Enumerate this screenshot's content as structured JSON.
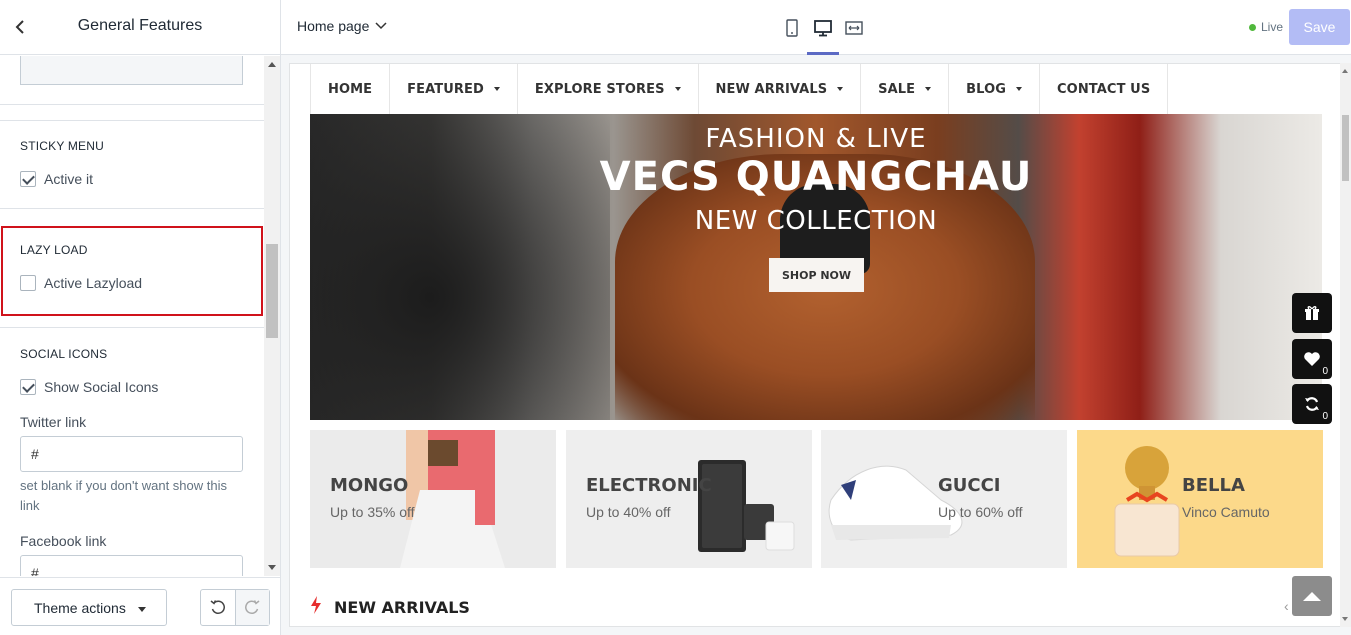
{
  "sidebar": {
    "title": "General Features",
    "sticky_menu": {
      "title": "STICKY MENU",
      "checkbox_label": "Active it",
      "checked": true
    },
    "lazy_load": {
      "title": "LAZY LOAD",
      "checkbox_label": "Active Lazyload",
      "checked": false
    },
    "social_icons": {
      "title": "SOCIAL ICONS",
      "checkbox_label": "Show Social Icons",
      "checked": true,
      "twitter_label": "Twitter link",
      "twitter_value": "#",
      "twitter_help": "set blank if you don't want show this link",
      "facebook_label": "Facebook link",
      "facebook_value": "#"
    },
    "footer": {
      "theme_actions": "Theme actions"
    }
  },
  "topbar": {
    "page_select": "Home page",
    "live_label": "Live",
    "save_label": "Save",
    "accent": "#5c6ac4"
  },
  "preview": {
    "nav": [
      {
        "label": "HOME",
        "dropdown": false
      },
      {
        "label": "FEATURED",
        "dropdown": true
      },
      {
        "label": "EXPLORE STORES",
        "dropdown": true
      },
      {
        "label": "NEW ARRIVALS",
        "dropdown": true
      },
      {
        "label": "SALE",
        "dropdown": true
      },
      {
        "label": "BLOG",
        "dropdown": true
      },
      {
        "label": "CONTACT US",
        "dropdown": false
      }
    ],
    "hero": {
      "line1": "FASHION & LIVE",
      "line2": "VECS QUANGCHAU",
      "line3": "NEW COLLECTION",
      "cta": "SHOP NOW"
    },
    "floating": {
      "wishlist_count": "0",
      "compare_count": "0"
    },
    "banners": [
      {
        "title": "MONGO",
        "subtitle": "Up to 35% off",
        "bg": "#ebebeb"
      },
      {
        "title": "ELECTRONIC",
        "subtitle": "Up to 40% off",
        "bg": "#eeeeee"
      },
      {
        "title": "GUCCI",
        "subtitle": "Up to 60% off",
        "bg": "#efefef"
      },
      {
        "title": "BELLA",
        "subtitle": "Vinco Camuto",
        "bg": "#fcd98a"
      }
    ],
    "section_title": "NEW ARRIVALS",
    "section_arrow": "‹"
  }
}
